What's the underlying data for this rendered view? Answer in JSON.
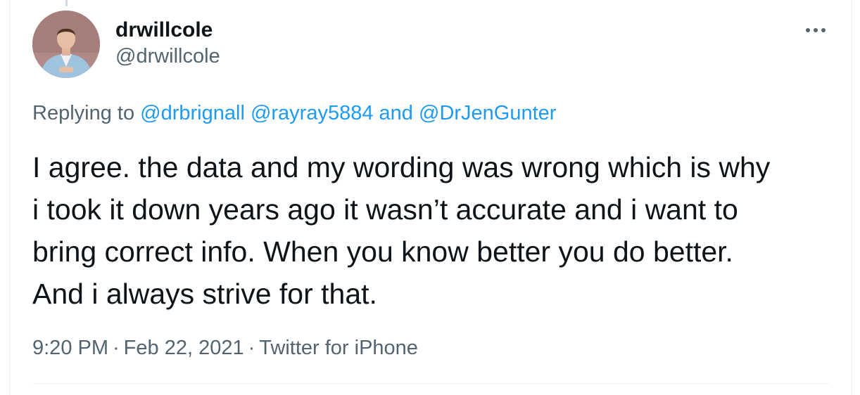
{
  "tweet": {
    "author": {
      "display_name": "drwillcole",
      "handle": "@drwillcole",
      "avatar_icon": "profile-photo"
    },
    "more_icon": "more-horizontal-icon",
    "reply_to": {
      "prefix": "Replying to",
      "mention_1": "@drbrignall",
      "mention_2": "@rayray5884",
      "conjunction": "and",
      "mention_3": "@DrJenGunter"
    },
    "text_lines": [
      "I agree. the data and my wording was wrong which is why",
      "i took it down years ago it wasn’t accurate and i want to",
      "bring correct info. When you know better you do better.",
      "And i always strive for that."
    ],
    "meta": {
      "time": "9:20 PM",
      "separator": "·",
      "date": "Feb 22, 2021",
      "source": "Twitter for iPhone"
    }
  },
  "colors": {
    "text_primary": "#0f1419",
    "text_secondary": "#536471",
    "link": "#1d9bf0",
    "divider": "#eff3f4"
  }
}
